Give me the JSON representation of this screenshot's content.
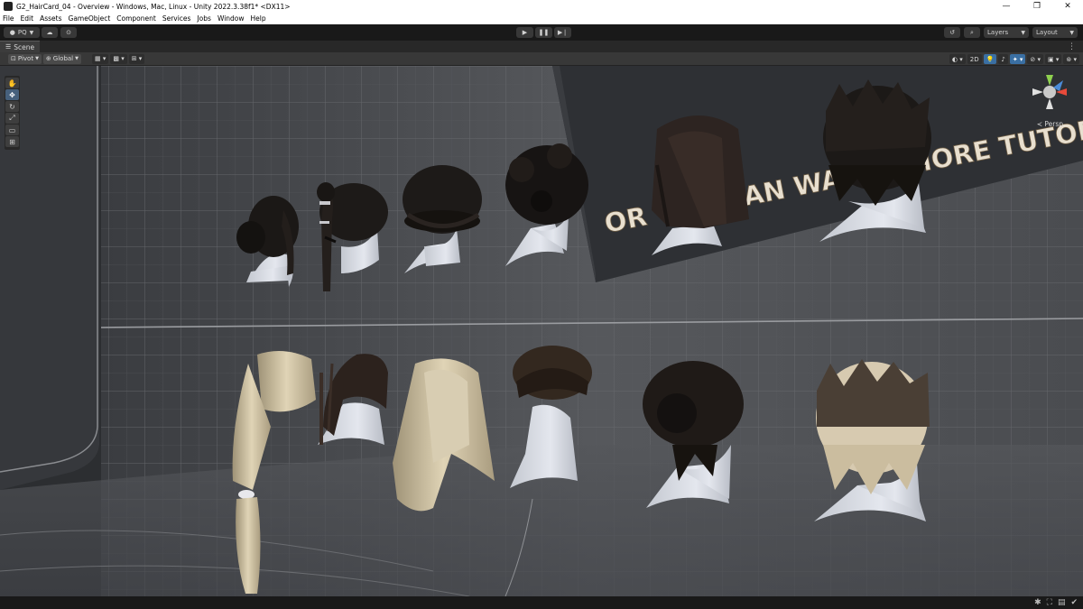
{
  "window": {
    "title": "G2_HairCard_04 - Overview - Windows, Mac, Linux - Unity 2022.3.38f1* <DX11>",
    "controls": [
      "minimize-icon",
      "restore-icon",
      "close-icon"
    ]
  },
  "menu": [
    "File",
    "Edit",
    "Assets",
    "GameObject",
    "Component",
    "Services",
    "Jobs",
    "Window",
    "Help"
  ],
  "toolbar": {
    "account": "PQ",
    "layers": "Layers",
    "layout": "Layout",
    "play_icons": [
      "play-icon",
      "pause-icon",
      "step-icon"
    ]
  },
  "scene_tab": {
    "label": "Scene"
  },
  "scene_toolbar": {
    "pivot": "Pivot",
    "global": "Global",
    "mode_2d": "2D"
  },
  "viewport": {
    "wall_text": "OR YOU CAN WATCH MORE TUTOR",
    "camera_mode": "Persp"
  },
  "colors": {
    "editor_bg": "#191919",
    "panel": "#383838",
    "scene_wall": "#4b4d50",
    "head": "#d9dce3",
    "dark_hair": "#1b1816",
    "blond_hair": "#cdbf9f",
    "accent": "#3a6fa3"
  }
}
